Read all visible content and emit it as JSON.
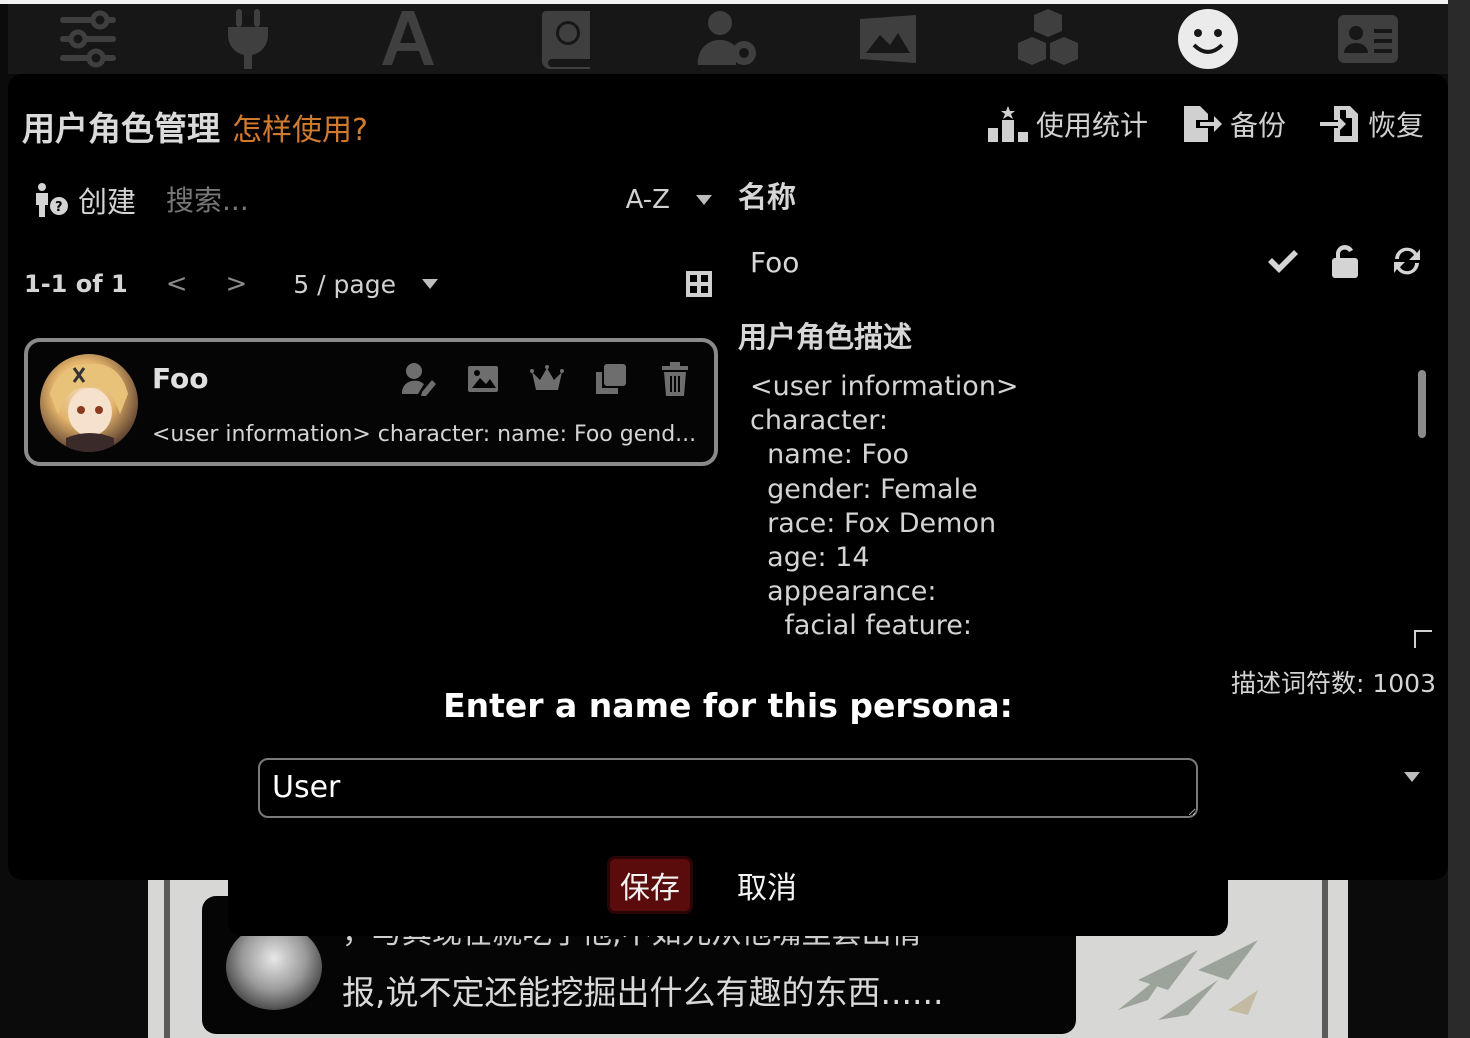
{
  "nav": {
    "items": [
      {
        "icon": "sliders-icon"
      },
      {
        "icon": "plug-icon"
      },
      {
        "icon": "font-icon"
      },
      {
        "icon": "world-book-icon"
      },
      {
        "icon": "user-gear-icon"
      },
      {
        "icon": "image-icon"
      },
      {
        "icon": "cubes-icon"
      },
      {
        "icon": "smile-icon",
        "active": true
      },
      {
        "icon": "id-card-icon"
      }
    ]
  },
  "panel": {
    "title": "用户角色管理",
    "help_link": "怎样使用?",
    "actions": {
      "usage_stats": "使用统计",
      "backup": "备份",
      "restore": "恢复"
    }
  },
  "left": {
    "create_label": "创建",
    "search_placeholder": "搜索...",
    "sort_value": "A-Z",
    "pager": {
      "range": "1-1 of 1",
      "prev": "<",
      "next": ">",
      "page_size": "5 / page"
    },
    "personas": [
      {
        "name": "Foo",
        "description": "<user information> character: name: Foo gend..."
      }
    ]
  },
  "right": {
    "name_label": "名称",
    "name_value": "Foo",
    "description_label": "用户角色描述",
    "description_text": "<user information>\ncharacter:\n  name: Foo\n  gender: Female\n  race: Fox Demon\n  age: 14\n  appearance:\n    facial feature:",
    "token_count": "描述词符数: 1003"
  },
  "dialog": {
    "title": "Enter a name for this persona:",
    "input_value": "User",
    "save_label": "保存",
    "cancel_label": "取消"
  },
  "background_chat": {
    "line1": "，与其现在就吃了他,不如先从他嘴里套出情",
    "line2": "报,说不定还能挖掘出什么有趣的东西......"
  },
  "colors": {
    "accent_link": "#d07a2e",
    "save_button": "#5a0b0b",
    "active_nav_icon": "#ebebeb",
    "inactive_nav_icon": "#3f3f3f"
  }
}
